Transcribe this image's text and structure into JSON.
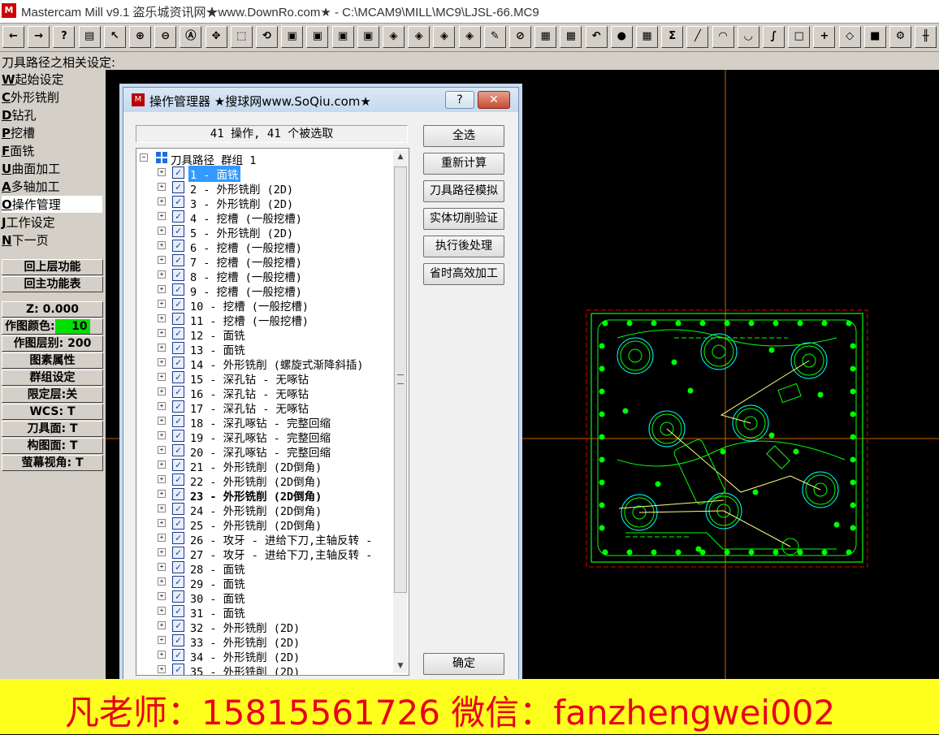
{
  "window": {
    "title": "Mastercam Mill v9.1 盗乐城资讯网★www.DownRo.com★ - C:\\MCAM9\\MILL\\MC9\\LJSL-66.MC9"
  },
  "toolbar": {
    "buttons": [
      {
        "icon": "arrow-left-icon",
        "glyph": "←"
      },
      {
        "icon": "arrow-right-icon",
        "glyph": "→"
      },
      {
        "icon": "help-icon",
        "glyph": "?"
      },
      {
        "icon": "calculator-icon",
        "glyph": "▤"
      },
      {
        "icon": "pick-help-icon",
        "glyph": "↖"
      },
      {
        "icon": "zoom-window-icon",
        "glyph": "⊕"
      },
      {
        "icon": "zoom-out-icon",
        "glyph": "⊖"
      },
      {
        "icon": "zoom-fit-icon",
        "glyph": "Ⓐ"
      },
      {
        "icon": "pan-icon",
        "glyph": "✥"
      },
      {
        "icon": "zoom-select-icon",
        "glyph": "⬚"
      },
      {
        "icon": "view-rotate-icon",
        "glyph": "⟲"
      },
      {
        "icon": "view-top-icon",
        "glyph": "▣"
      },
      {
        "icon": "view-front-icon",
        "glyph": "▣"
      },
      {
        "icon": "view-side-icon",
        "glyph": "▣"
      },
      {
        "icon": "view-iso-icon",
        "glyph": "▣"
      },
      {
        "icon": "cube-1-icon",
        "glyph": "◈"
      },
      {
        "icon": "cube-2-icon",
        "glyph": "◈"
      },
      {
        "icon": "cube-3-icon",
        "glyph": "◈"
      },
      {
        "icon": "cube-4-icon",
        "glyph": "◈"
      },
      {
        "icon": "pencil-icon",
        "glyph": "✎"
      },
      {
        "icon": "no-tool-icon",
        "glyph": "⊘"
      },
      {
        "icon": "layers-icon",
        "glyph": "▦"
      },
      {
        "icon": "levels-icon",
        "glyph": "▦"
      },
      {
        "icon": "undo-icon",
        "glyph": "↶"
      },
      {
        "icon": "sphere-icon",
        "glyph": "●"
      },
      {
        "icon": "group-icon",
        "glyph": "▦"
      },
      {
        "icon": "sum-icon",
        "glyph": "Σ"
      },
      {
        "icon": "line-icon",
        "glyph": "╱"
      },
      {
        "icon": "arc-icon",
        "glyph": "◠"
      },
      {
        "icon": "fillet-icon",
        "glyph": "◡"
      },
      {
        "icon": "spline-icon",
        "glyph": "∫"
      },
      {
        "icon": "rectangle-icon",
        "glyph": "□"
      },
      {
        "icon": "point-icon",
        "glyph": "+"
      },
      {
        "icon": "surface-icon",
        "glyph": "◇"
      },
      {
        "icon": "solid-icon",
        "glyph": "■"
      },
      {
        "icon": "gear-icon",
        "glyph": "⚙"
      },
      {
        "icon": "more-icon",
        "glyph": "╫"
      }
    ]
  },
  "prompt": "刀具路径之相关设定:",
  "menu": {
    "items": [
      {
        "key": "W",
        "label": "起始设定"
      },
      {
        "key": "C",
        "label": "外形铣削"
      },
      {
        "key": "D",
        "label": "钻孔"
      },
      {
        "key": "P",
        "label": "挖槽"
      },
      {
        "key": "F",
        "label": "面铣"
      },
      {
        "key": "U",
        "label": "曲面加工"
      },
      {
        "key": "A",
        "label": "多轴加工"
      },
      {
        "key": "O",
        "label": "操作管理"
      },
      {
        "key": "J",
        "label": "工作设定"
      },
      {
        "key": "N",
        "label": "下一页"
      }
    ],
    "selected_key": "O",
    "buttons": [
      "回上层功能",
      "回主功能表"
    ],
    "status": {
      "z": "Z:  0.000",
      "color_label": "作图颜色:",
      "color_value": "10",
      "level": "作图层别: 200",
      "attributes": "图素属性",
      "group": "群组设定",
      "mask": "限定层:关",
      "wcs": "WCS:  T",
      "tool_plane": "刀具面: T",
      "construction_plane": "构图面: T",
      "screen_view": "萤幕视角: T"
    }
  },
  "dialog": {
    "title": "操作管理器 ★搜球网www.SoQiu.com★",
    "help_label": "?",
    "close_label": "✕",
    "status": "41 操作, 41 个被选取",
    "root": "刀具路径 群组 1",
    "ops": [
      "1 - 面铣",
      "2 - 外形铣削 (2D)",
      "3 - 外形铣削 (2D)",
      "4 - 挖槽 (一般挖槽)",
      "5 - 外形铣削 (2D)",
      "6 - 挖槽 (一般挖槽)",
      "7 - 挖槽 (一般挖槽)",
      "8 - 挖槽 (一般挖槽)",
      "9 - 挖槽 (一般挖槽)",
      "10 - 挖槽 (一般挖槽)",
      "11 - 挖槽 (一般挖槽)",
      "12 - 面铣",
      "13 - 面铣",
      "14 - 外形铣削 (螺旋式渐降斜插)",
      "15 - 深孔钻 - 无啄钻",
      "16 - 深孔钻 - 无啄钻",
      "17 - 深孔钻 - 无啄钻",
      "18 - 深孔啄钻 - 完整回缩",
      "19 - 深孔啄钻 - 完整回缩",
      "20 - 深孔啄钻 - 完整回缩",
      "21 - 外形铣削 (2D倒角)",
      "22 - 外形铣削 (2D倒角)",
      "23 - 外形铣削 (2D倒角)",
      "24 - 外形铣削 (2D倒角)",
      "25 - 外形铣削 (2D倒角)",
      "26 - 攻牙 - 进给下刀,主轴反转 -",
      "27 - 攻牙 - 进给下刀,主轴反转 -",
      "28 - 面铣",
      "29 - 面铣",
      "30 - 面铣",
      "31 - 面铣",
      "32 - 外形铣削 (2D)",
      "33 - 外形铣削 (2D)",
      "34 - 外形铣削 (2D)",
      "35 - 外形铣削 (2D)"
    ],
    "highlighted_index": 0,
    "bold_index": 22,
    "buttons": [
      "全选",
      "重新计算",
      "刀具路径模拟",
      "实体切削验证",
      "执行後处理",
      "省时高效加工"
    ],
    "ok_label": "确定"
  },
  "banner": "凡老师：15815561726 微信：fanzhengwei002",
  "colors": {
    "geometry": "#00ff00",
    "toolpath": "#00ffff",
    "crosshair": "#c86400",
    "banner_bg": "#ffff1e",
    "banner_text": "#e8001c",
    "selection": "#3399ff"
  }
}
